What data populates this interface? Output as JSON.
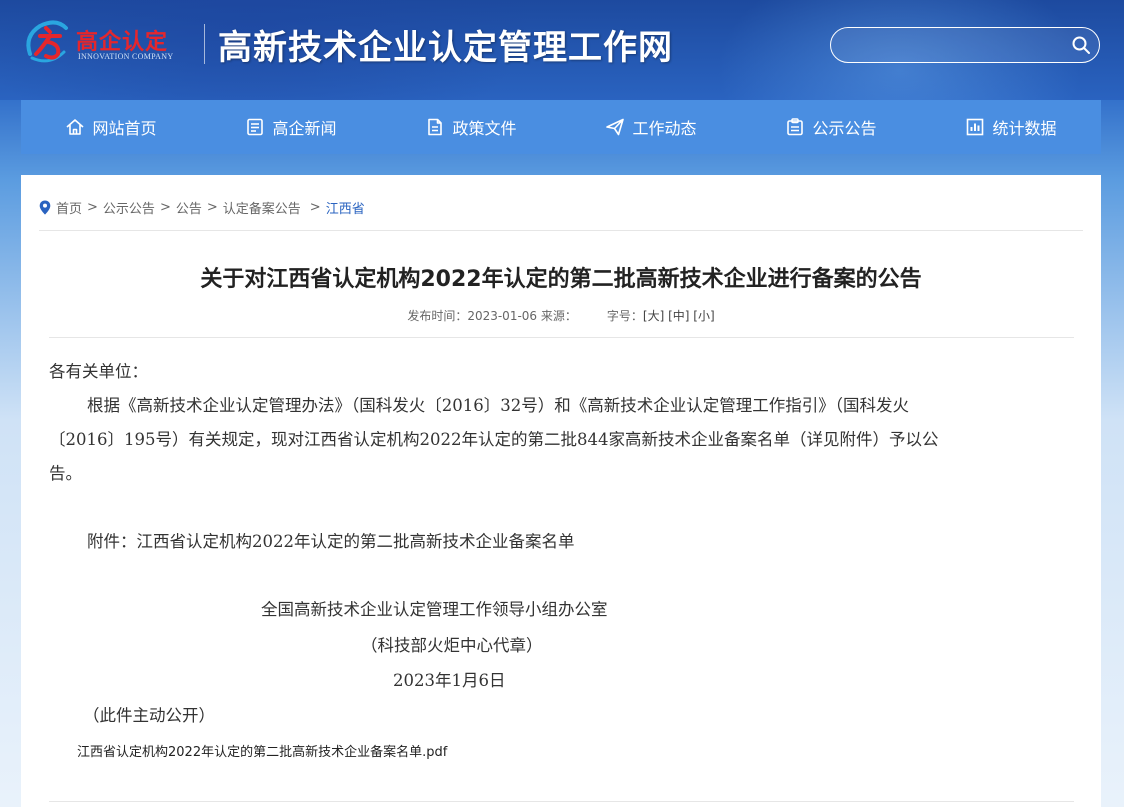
{
  "header": {
    "logo_cn": "高企认定",
    "logo_en": "INNOVATION COMPANY",
    "site_title": "高新技术企业认定管理工作网",
    "search_placeholder": ""
  },
  "nav": [
    {
      "label": "网站首页",
      "icon": "home-icon"
    },
    {
      "label": "高企新闻",
      "icon": "news-icon"
    },
    {
      "label": "政策文件",
      "icon": "document-icon"
    },
    {
      "label": "工作动态",
      "icon": "paper-plane-icon"
    },
    {
      "label": "公示公告",
      "icon": "clipboard-icon"
    },
    {
      "label": "统计数据",
      "icon": "bar-chart-icon"
    }
  ],
  "breadcrumb": {
    "items": [
      "首页",
      "公示公告",
      "公告",
      "认定备案公告"
    ],
    "current": "江西省"
  },
  "article": {
    "title": "关于对江西省认定机构2022年认定的第二批高新技术企业进行备案的公告",
    "meta_time": "发布时间：2023-01-06 来源：",
    "meta_size_label": "字号：",
    "size_large": "[大]",
    "size_medium": "[中]",
    "size_small": "[小]",
    "salutation": "各有关单位：",
    "para1_a": "根据《高新技术企业认定管理办法》（国科发火〔2016〕32号）和《高新技术企业认定管理工作指引》（国科发火",
    "para1_b": "〔2016〕195号）有关规定，现对江西省认定机构2022年认定的第二批844家高新技术企业备案名单（详见附件）予以公",
    "para1_c": "告。",
    "attachment_line": "附件：江西省认定机构2022年认定的第二批高新技术企业备案名单",
    "sign_org": "全国高新技术企业认定管理工作领导小组办公室",
    "sign_seal": "（科技部火炬中心代章）",
    "sign_date": "2023年1月6日",
    "public_note": "（此件主动公开）",
    "attachment_file": "江西省认定机构2022年认定的第二批高新技术企业备案名单.pdf"
  },
  "colors": {
    "nav_bg": "#4a8ee1",
    "accent": "#2a63c0",
    "logo_red": "#e5262c"
  }
}
